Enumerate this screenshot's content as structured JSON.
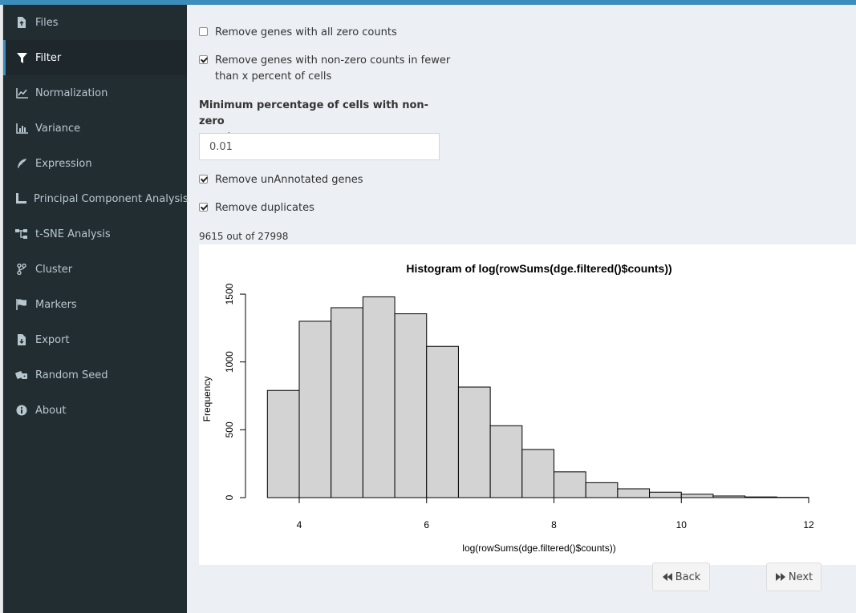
{
  "sidebar": {
    "items": [
      {
        "label": "Files",
        "icon": "file-upload-icon"
      },
      {
        "label": "Filter",
        "icon": "filter-icon"
      },
      {
        "label": "Normalization",
        "icon": "line-chart-icon"
      },
      {
        "label": "Variance",
        "icon": "bar-chart-icon"
      },
      {
        "label": "Expression",
        "icon": "feather-icon"
      },
      {
        "label": "Principal Component Analysis",
        "icon": "ruler-icon"
      },
      {
        "label": "t-SNE Analysis",
        "icon": "sitemap-icon"
      },
      {
        "label": "Cluster",
        "icon": "code-fork-icon"
      },
      {
        "label": "Markers",
        "icon": "flag-icon"
      },
      {
        "label": "Export",
        "icon": "file-download-icon"
      },
      {
        "label": "Random Seed",
        "icon": "dice-icon"
      },
      {
        "label": "About",
        "icon": "info-circle-icon"
      }
    ],
    "active_label": "Filter"
  },
  "filter": {
    "remove_zero_label": "Remove genes with all zero counts",
    "remove_zero_checked": false,
    "remove_fewer_label_line1": "Remove genes with non-zero counts in fewer",
    "remove_fewer_label_line2": "than x percent of cells",
    "remove_fewer_checked": true,
    "min_pct_label_line1": "Minimum percentage of cells with non-zero",
    "min_pct_label_line2": "counts",
    "min_pct_value": "0.01",
    "remove_unannotated_label": "Remove unAnnotated genes",
    "remove_unannotated_checked": true,
    "remove_duplicates_label": "Remove duplicates",
    "remove_duplicates_checked": true,
    "count_text": "9615 out of 27998"
  },
  "chart_data": {
    "type": "bar",
    "title": "Histogram of log(rowSums(dge.filtered()$counts))",
    "xlabel": "log(rowSums(dge.filtered()$counts))",
    "ylabel": "Frequency",
    "bin_edges": [
      3.5,
      4.0,
      4.5,
      5.0,
      5.5,
      6.0,
      6.5,
      7.0,
      7.5,
      8.0,
      8.5,
      9.0,
      9.5,
      10.0,
      10.5,
      11.0,
      11.5,
      12.0
    ],
    "values": [
      790,
      1300,
      1400,
      1480,
      1355,
      1115,
      815,
      530,
      355,
      190,
      110,
      65,
      40,
      25,
      12,
      5,
      2
    ],
    "xlim": [
      3.5,
      12
    ],
    "ylim": [
      0,
      1500
    ],
    "xticks": [
      "4",
      "6",
      "8",
      "10",
      "12"
    ],
    "yticks": [
      "0",
      "500",
      "1000",
      "1500"
    ],
    "bar_color": "#d3d3d3",
    "grid": false
  },
  "nav_buttons": {
    "back_label": "Back",
    "next_label": "Next"
  }
}
